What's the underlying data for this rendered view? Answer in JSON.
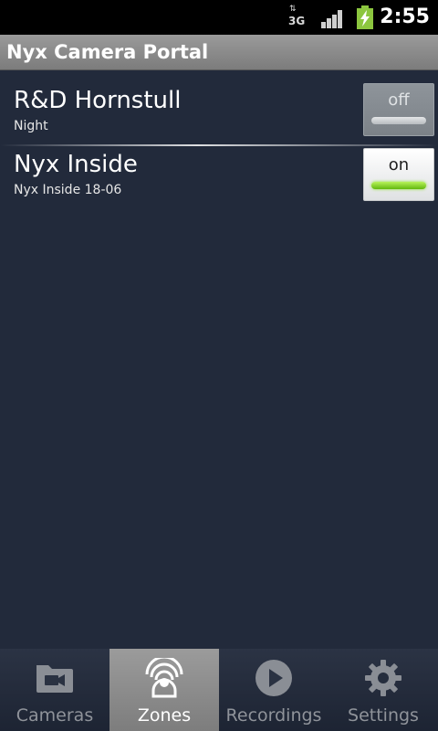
{
  "status_bar": {
    "network": "3G",
    "time": "2:55"
  },
  "app": {
    "title": "Nyx Camera Portal"
  },
  "zones": [
    {
      "name": "R&D Hornstull",
      "subtitle": "Night",
      "toggle": "off"
    },
    {
      "name": "Nyx Inside",
      "subtitle": "Nyx Inside 18-06",
      "toggle": "on"
    }
  ],
  "tabs": [
    {
      "label": "Cameras",
      "icon": "camera-folder-icon",
      "active": false
    },
    {
      "label": "Zones",
      "icon": "zones-icon",
      "active": true
    },
    {
      "label": "Recordings",
      "icon": "play-icon",
      "active": false
    },
    {
      "label": "Settings",
      "icon": "gear-icon",
      "active": false
    }
  ],
  "colors": {
    "background": "#222a3b",
    "accent_on": "#8be02a",
    "battery": "#8cc63f"
  }
}
